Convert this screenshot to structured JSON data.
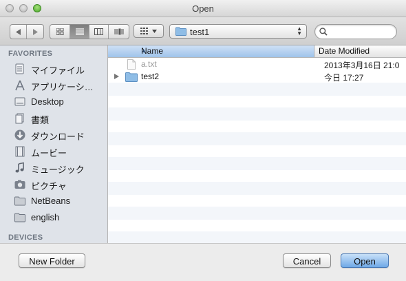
{
  "window": {
    "title": "Open"
  },
  "toolbar": {
    "nav_back_icon": "back-arrow-icon",
    "nav_forward_icon": "forward-arrow-icon",
    "view_modes": [
      "icon-view",
      "list-view",
      "column-view",
      "coverflow-view"
    ],
    "active_view": "list-view",
    "path_label": "test1",
    "search_placeholder": "",
    "search_value": ""
  },
  "sidebar": {
    "favorites_heading": "FAVORITES",
    "devices_heading": "DEVICES",
    "items": [
      {
        "label": "マイファイル",
        "icon": "all-my-files-icon"
      },
      {
        "label": "アプリケーシ…",
        "icon": "applications-icon"
      },
      {
        "label": "Desktop",
        "icon": "desktop-icon"
      },
      {
        "label": "書類",
        "icon": "documents-icon"
      },
      {
        "label": "ダウンロード",
        "icon": "downloads-icon"
      },
      {
        "label": "ムービー",
        "icon": "movies-icon"
      },
      {
        "label": "ミュージック",
        "icon": "music-icon"
      },
      {
        "label": "ピクチャ",
        "icon": "pictures-icon"
      },
      {
        "label": "NetBeans",
        "icon": "folder-icon"
      },
      {
        "label": "english",
        "icon": "folder-icon"
      }
    ]
  },
  "filelist": {
    "columns": {
      "name": "Name",
      "date": "Date Modified"
    },
    "rows": [
      {
        "name": "a.txt",
        "date": "2013年3月16日 21:0",
        "kind": "file",
        "disabled": true
      },
      {
        "name": "test2",
        "date": "今日 17:27",
        "kind": "folder",
        "disabled": false
      }
    ]
  },
  "buttons": {
    "new_folder": "New Folder",
    "cancel": "Cancel",
    "open": "Open"
  },
  "colors": {
    "accent": "#6fa9e7",
    "sidebar_bg": "#dfe3e9",
    "folder": "#8fbde6"
  }
}
